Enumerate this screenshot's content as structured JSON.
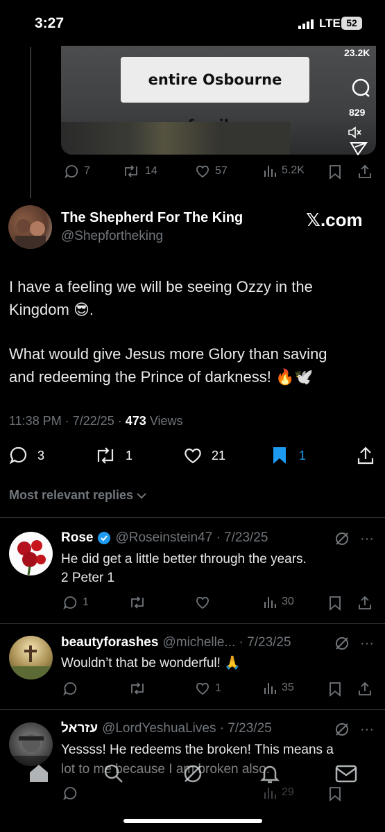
{
  "status": {
    "time": "3:27",
    "network": "LTE",
    "battery": "52"
  },
  "video": {
    "caption": "entire Osbourne family.",
    "likes": "23.2K",
    "comments": "829"
  },
  "prev_actions": {
    "replies": "7",
    "reposts": "14",
    "likes": "57",
    "views": "5.2K"
  },
  "tweet": {
    "author": "The Shepherd For The King",
    "handle": "@Shepfortheking",
    "source": "𝕏.com",
    "line1": "I have a feeling we will be seeing Ozzy in the",
    "line2": "Kingdom 😎.",
    "line3": "What would give Jesus more Glory than saving",
    "line4": "and redeeming the Prince of darkness! 🔥🕊️",
    "time": "11:38 PM · 7/22/25 · ",
    "views_count": "473",
    "views_label": " Views",
    "replies": "3",
    "reposts": "1",
    "likes": "21",
    "bookmarks": "1"
  },
  "replies_header": "Most relevant replies",
  "replies": [
    {
      "name": "Rose",
      "handle": "@Roseinstein47 · 7/23/25",
      "text1": "He did get a little better through the years.",
      "text2": "2 Peter 1",
      "replies": "1",
      "reposts": "",
      "likes": "",
      "views": "30"
    },
    {
      "name": "beautyforashes",
      "handle": "@michelle... · 7/23/25",
      "text1": "Wouldn’t that be wonderful! 🙏",
      "replies": "",
      "reposts": "",
      "likes": "1",
      "views": "35"
    },
    {
      "name": "עזראל",
      "handle": "@LordYeshuaLives · 7/23/25",
      "text1": "Yessss! He redeems the broken! This means a",
      "text2": "lot to me because I am broken also.",
      "views": "29"
    }
  ],
  "colors": {
    "accent": "#1d9bf0",
    "muted": "#71767b",
    "verified": "#1d9bf0"
  }
}
